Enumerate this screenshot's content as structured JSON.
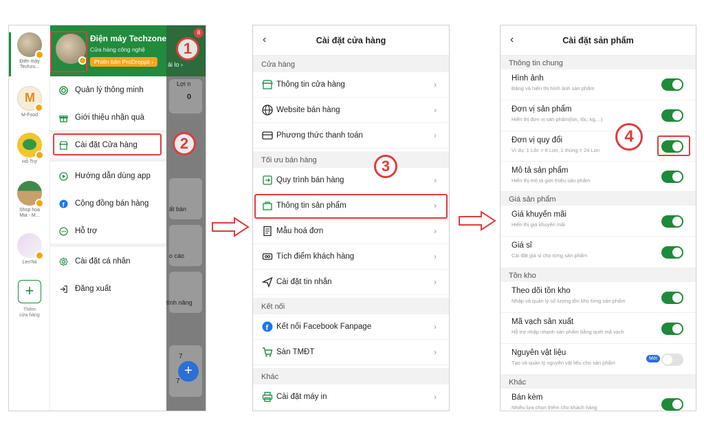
{
  "phone1": {
    "rail_stores": [
      {
        "name": "Điện máy\nTechzo..."
      },
      {
        "name": "M-Food"
      },
      {
        "name": "Hỗ Trợ"
      },
      {
        "name": "Shop hoa\nMia - M..."
      },
      {
        "name": "Len'Nii"
      }
    ],
    "rail_add_label": "Thêm\ncửa hàng",
    "store_title": "Điện máy Techzone",
    "store_subtitle": "Cửa hàng công nghệ",
    "plan_pill": "Phiên bản ProDroppii ›",
    "menu": [
      {
        "label": "Quản lý thông minh",
        "icon": "spiral-icon"
      },
      {
        "label": "Giới thiệu nhận quà",
        "icon": "gift-icon"
      },
      {
        "label": "Cài đặt Cửa hàng",
        "icon": "store-icon"
      },
      {
        "label": "Hướng dẫn dùng app",
        "icon": "play-icon"
      },
      {
        "label": "Cộng đồng bán hàng",
        "icon": "facebook-icon"
      },
      {
        "label": "Hỗ trợ",
        "icon": "chat-icon"
      },
      {
        "label": "Cài đặt cá nhân",
        "icon": "gear-icon"
      },
      {
        "label": "Đăng xuất",
        "icon": "logout-icon"
      }
    ],
    "bg_texts": {
      "link": "ải lo ›",
      "profit": "Lợi n",
      "zero": "0",
      "sell": "ất bàn",
      "report": "o cáo",
      "features": "tính năng",
      "seven_a": "7",
      "seven_b": "7",
      "notif_count": "8"
    },
    "steps": {
      "one": "1",
      "two": "2"
    }
  },
  "phone2": {
    "title": "Cài đặt cửa hàng",
    "sections": [
      {
        "header": "Cửa hàng",
        "rows": [
          {
            "label": "Thông tin cửa hàng",
            "icon": "store-icon"
          },
          {
            "label": "Website bán hàng",
            "icon": "globe-icon"
          },
          {
            "label": "Phương thức thanh toán",
            "icon": "card-icon"
          }
        ]
      },
      {
        "header": "Tối ưu bán hàng",
        "rows": [
          {
            "label": "Quy trình bán hàng",
            "icon": "process-icon"
          },
          {
            "label": "Thông tin sản phẩm",
            "icon": "product-icon"
          },
          {
            "label": "Mẫu hoá đơn",
            "icon": "invoice-icon"
          },
          {
            "label": "Tích điểm khách hàng",
            "icon": "points-icon"
          },
          {
            "label": "Cài đặt tin nhắn",
            "icon": "send-icon"
          }
        ]
      },
      {
        "header": "Kết nối",
        "rows": [
          {
            "label": "Kết nối Facebook Fanpage",
            "icon": "facebook-icon"
          },
          {
            "label": "Sàn TMĐT",
            "icon": "cart-icon"
          }
        ]
      },
      {
        "header": "Khác",
        "rows": [
          {
            "label": "Cài đặt máy in",
            "icon": "printer-icon"
          }
        ]
      }
    ],
    "step": "3"
  },
  "phone3": {
    "title": "Cài đặt sản phẩm",
    "sections": [
      {
        "header": "Thông tin chung",
        "rows": [
          {
            "title": "Hình ảnh",
            "desc": "Đăng và hiển thị hình ảnh sản phẩm",
            "on": true
          },
          {
            "title": "Đơn vị sản phẩm",
            "desc": "Hiển thị đơn vị sản phẩm(lon, lốc, kg,...)",
            "on": true
          },
          {
            "title": "Đơn vị quy đổi",
            "desc": "Ví dụ: 1 Lốc = 6 Lon, 1 thùng = 24 Lon",
            "on": true
          },
          {
            "title": "Mô tả sản phẩm",
            "desc": "Hiển thị mô tả giới thiệu sản phẩm",
            "on": true
          }
        ]
      },
      {
        "header": "Giá sản phẩm",
        "rows": [
          {
            "title": "Giá khuyến mãi",
            "desc": "Hiển thị giá khuyến mãi",
            "on": true
          },
          {
            "title": "Giá sỉ",
            "desc": "Cài đặt giá sỉ cho từng sản phẩm",
            "on": true
          }
        ]
      },
      {
        "header": "Tồn kho",
        "rows": [
          {
            "title": "Theo dõi tồn kho",
            "desc": "Nhập và quản lý số lượng tồn kho từng sản phẩm",
            "on": true
          },
          {
            "title": "Mã vạch sản xuất",
            "desc": "Hỗ trợ nhập nhanh sản phẩm bằng quét mã vạch",
            "on": true
          },
          {
            "title": "Nguyên vật liệu",
            "desc": "Tạo và quản lý nguyên vật liệu cho sản phẩm",
            "on": false,
            "badge": "Mới"
          }
        ]
      },
      {
        "header": "Khác",
        "rows": [
          {
            "title": "Bán kèm",
            "desc": "Nhiều lựa chọn thêm cho khách hàng",
            "on": true
          }
        ]
      }
    ],
    "step": "4"
  },
  "colors": {
    "accent_green": "#228b3e",
    "highlight_red": "#e23b3b",
    "pill_orange": "#f4a61c"
  }
}
